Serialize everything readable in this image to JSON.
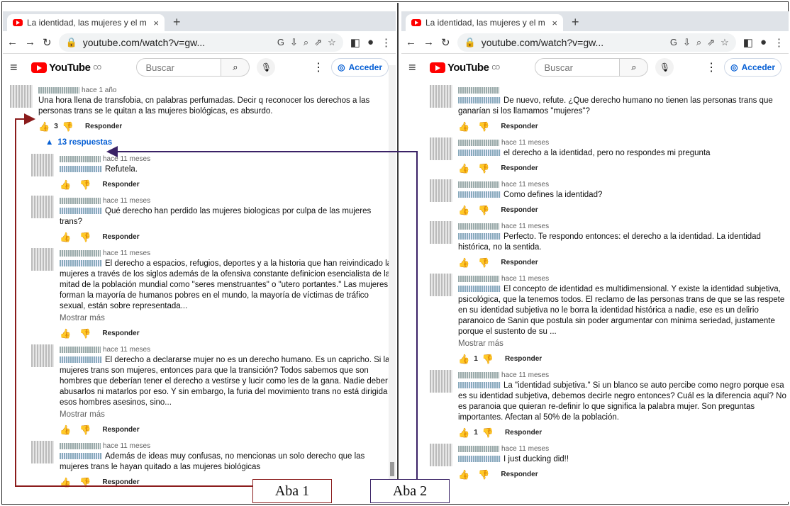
{
  "tab": {
    "title": "La identidad, las mujeres y el m",
    "close": "×",
    "new": "+"
  },
  "address": {
    "url": "youtube.com/watch?v=gw..."
  },
  "yt": {
    "logo_text": "YouTube",
    "logo_sup": "CO",
    "search_placeholder": "Buscar",
    "signin": "Acceder"
  },
  "labels": {
    "aba1": "Aba 1",
    "aba2": "Aba 2"
  },
  "pane1": {
    "parent": {
      "time": "hace 1 año",
      "text": "Una hora llena de transfobia, cn palabras perfumadas. Decir q reconocer los derechos a las personas trans se le quitan a las mujeres biológicas, es absurdo.",
      "likes": "3",
      "reply": "Responder"
    },
    "replies_toggle": "13 respuestas",
    "replies": [
      {
        "time": "hace 11 meses",
        "text": "Refutela.",
        "likes": "",
        "more": "",
        "reply": "Responder"
      },
      {
        "time": "hace 11 meses",
        "text": "Qué derecho han perdido las mujeres biologicas por culpa de las mujeres trans?",
        "likes": "",
        "more": "",
        "reply": "Responder"
      },
      {
        "time": "hace 11 meses",
        "text": "El derecho a espacios, refugios, deportes y a la historia que han reivindicado las mujeres a través de los siglos además de la ofensiva constante definicion esencialista de la mitad de la población mundial como \"seres menstruantes\" o \"utero portantes.\" Las mujeres forman la mayoría de humanos pobres en el mundo, la mayoría de víctimas de tráfico sexual, están sobre representada...",
        "likes": "",
        "more": "Mostrar más",
        "reply": "Responder"
      },
      {
        "time": "hace 11 meses",
        "text": "El derecho a declararse mujer no es un derecho humano. Es un capricho. Si las mujeres trans son mujeres, entonces para que la transición? Todos sabemos que son hombres que deberían tener el derecho a vestirse y lucir como les de la gana. Nadie debería abusarlos ni matarlos por eso. Y sin embargo, la furia del movimiento trans no está dirigida a esos hombres asesinos, sino...",
        "likes": "",
        "more": "Mostrar más",
        "reply": "Responder"
      },
      {
        "time": "hace 11 meses",
        "text": "Además de ideas muy confusas, no mencionas un solo derecho que las mujeres trans le hayan quitado a las mujeres biológicas",
        "likes": "",
        "more": "",
        "reply": "Responder"
      }
    ]
  },
  "pane2": {
    "replies": [
      {
        "time": "",
        "text": "De nuevo, refute. ¿Que derecho humano no tienen las personas trans que ganarían si los llamamos \"mujeres\"?",
        "likes": "",
        "more": "",
        "reply": "Responder"
      },
      {
        "time": "hace 11 meses",
        "text": "el derecho a la identidad, pero no respondes mi pregunta",
        "likes": "",
        "more": "",
        "reply": "Responder"
      },
      {
        "time": "hace 11 meses",
        "text": "Como defines la identidad?",
        "likes": "",
        "more": "",
        "reply": "Responder"
      },
      {
        "time": "hace 11 meses",
        "text": "Perfecto. Te respondo entonces: el derecho a la identidad. La identidad histórica, no la sentida.",
        "likes": "",
        "more": "",
        "reply": "Responder"
      },
      {
        "time": "hace 11 meses",
        "text": "El concepto de identidad es multidimensional. Y existe la identidad subjetiva, psicológica, que la tenemos todos. El reclamo de las personas trans de que se las respete en su identidad subjetiva no le borra la identidad histórica a nadie, ese es un delirio paranoico de Sanin que postula sin poder argumentar con mínima seriedad, justamente porque el sustento de su ...",
        "likes": "1",
        "more": "Mostrar más",
        "reply": "Responder"
      },
      {
        "time": "hace 11 meses",
        "text": "La \"identidad subjetiva.\" Si un blanco se auto percibe como negro porque esa es su identidad subjetiva, debemos decirle negro entonces? Cuál es la diferencia aquí? No es paranoia que quieran re-definir lo que significa la palabra mujer. Son preguntas importantes. Afectan al 50% de la población.",
        "likes": "1",
        "more": "",
        "reply": "Responder"
      },
      {
        "time": "hace 11 meses",
        "text": "I just ducking did!!",
        "likes": "",
        "more": "",
        "reply": "Responder"
      }
    ]
  }
}
